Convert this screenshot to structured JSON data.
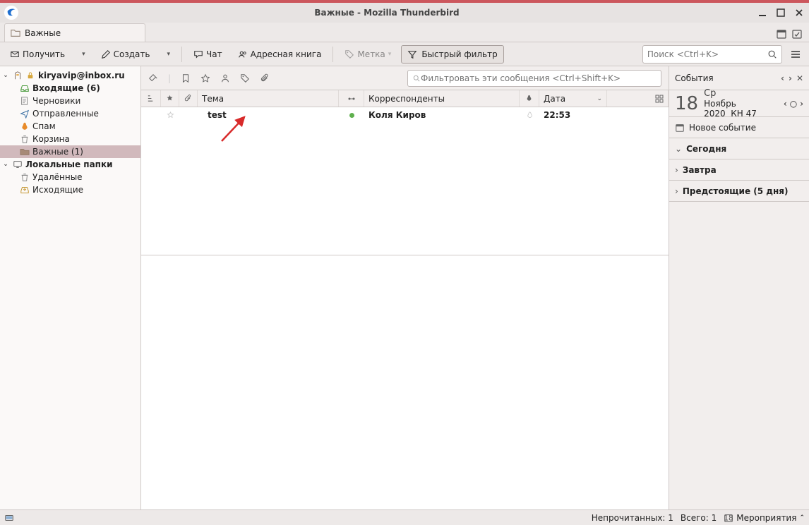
{
  "window": {
    "title": "Важные - Mozilla Thunderbird"
  },
  "tab": {
    "label": "Важные"
  },
  "toolbar": {
    "get": "Получить",
    "compose": "Создать",
    "chat": "Чат",
    "addressbook": "Адресная книга",
    "tag": "Метка",
    "quickfilter": "Быстрый фильтр",
    "search_placeholder": "Поиск <Ctrl+K>"
  },
  "tree": {
    "account": "kiryavip@inbox.ru",
    "inbox": "Входящие (6)",
    "drafts": "Черновики",
    "sent": "Отправленные",
    "spam": "Спам",
    "trash": "Корзина",
    "important": "Важные (1)",
    "local": "Локальные папки",
    "local_trash": "Удалённые",
    "local_outbox": "Исходящие"
  },
  "quickfilter": {
    "filter_placeholder": "Фильтровать эти сообщения <Ctrl+Shift+K>"
  },
  "columns": {
    "subject": "Тема",
    "correspondents": "Корреспонденты",
    "date": "Дата"
  },
  "message": {
    "subject": "test",
    "correspondent": "Коля Киров",
    "date": "22:53"
  },
  "events": {
    "header": "События",
    "day": "18",
    "weekday": "Ср",
    "month_year": "Ноябрь 2020",
    "week": "КН 47",
    "new_event": "Новое событие",
    "today": "Сегодня",
    "tomorrow": "Завтра",
    "upcoming": "Предстоящие (5 дня)"
  },
  "status": {
    "unread": "Непрочитанных: 1",
    "total": "Всего: 1",
    "events_toggle": "Мероприятия"
  }
}
